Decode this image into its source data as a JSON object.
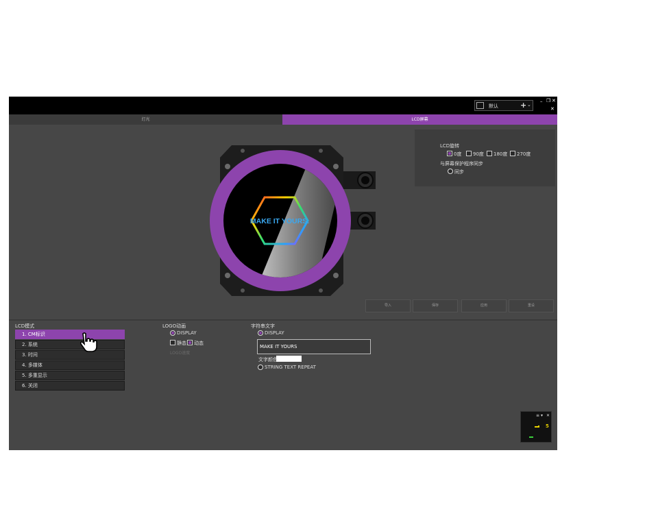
{
  "titlebar": {
    "profile_name": "默认",
    "add_label": "+",
    "chevron": "⌄",
    "minimize": "–",
    "restore": "❐",
    "close": "✕",
    "pin": "✕"
  },
  "tabs": [
    {
      "label": "灯光"
    },
    {
      "label": "LCD屏幕",
      "active": true
    }
  ],
  "preview": {
    "screen_text": "MAKE IT YOURS.",
    "ring_color": "#8d44ad"
  },
  "lcd_settings": {
    "rotation_title": "LCD旋转",
    "rotations": [
      {
        "label": "0度",
        "checked": true
      },
      {
        "label": "90度",
        "checked": false
      },
      {
        "label": "180度",
        "checked": false
      },
      {
        "label": "270度",
        "checked": false
      }
    ],
    "screensaver_title": "与屏幕保护程序同步",
    "sync_label": "同步"
  },
  "action_buttons": [
    "导入",
    "保存",
    "应用",
    "重设"
  ],
  "lcd_mode": {
    "title": "LCD模式",
    "items": [
      "1. CM标识",
      "2. 系统",
      "3. 时间",
      "4. 多媒体",
      "5. 多重显示",
      "6. 关闭"
    ],
    "selected_index": 0
  },
  "logo_animation": {
    "title": "LOGO动画",
    "display_label": "DISPLAY",
    "static_label": "静态",
    "dynamic_label": "动态",
    "speed_label": "LOGO速度"
  },
  "string_text": {
    "title": "字符串文字",
    "display_label": "DISPLAY",
    "value": "MAKE IT YOURS",
    "color_label": "文字颜色",
    "repeat_label": "STRING TEXT REPEAT"
  },
  "mini_widget": {
    "menu": "≡",
    "down": "▾",
    "close": "✕",
    "value": "5"
  },
  "colors": {
    "accent": "#8d44ad",
    "background": "#474747",
    "titlebar": "#000000"
  }
}
